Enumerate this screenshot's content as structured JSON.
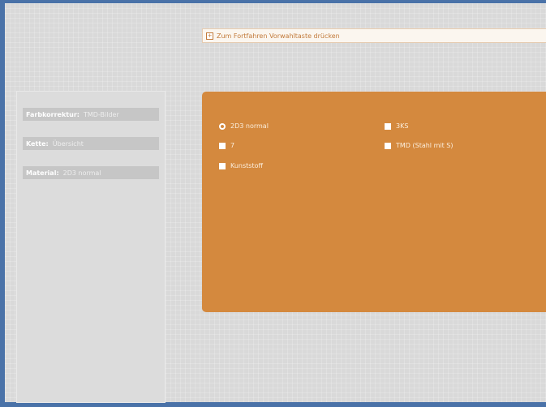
{
  "hint": {
    "icon": "plus-icon",
    "icon_glyph": "+",
    "text": "Zum Fortfahren Vorwahltaste drücken"
  },
  "left_panel": {
    "fields": [
      {
        "label": "Farbkorrektur:",
        "value": "TMD-Bilder"
      },
      {
        "label": "Kette:",
        "value": "Übersicht"
      },
      {
        "label": "Material:",
        "value": "2D3 normal"
      }
    ]
  },
  "options": {
    "col1": [
      {
        "label": "2D3 normal",
        "type": "radio",
        "selected": true
      },
      {
        "label": "7",
        "type": "checkbox",
        "selected": false
      },
      {
        "label": "Kunststoff",
        "type": "checkbox",
        "selected": false
      }
    ],
    "col2": [
      {
        "label": "3KS",
        "type": "checkbox",
        "selected": false
      },
      {
        "label": "TMD (Stahl mit S)",
        "type": "checkbox",
        "selected": false
      }
    ]
  },
  "colors": {
    "accent": "#d4893e",
    "background": "#d9d9d9",
    "frame": "#4a72a8"
  }
}
